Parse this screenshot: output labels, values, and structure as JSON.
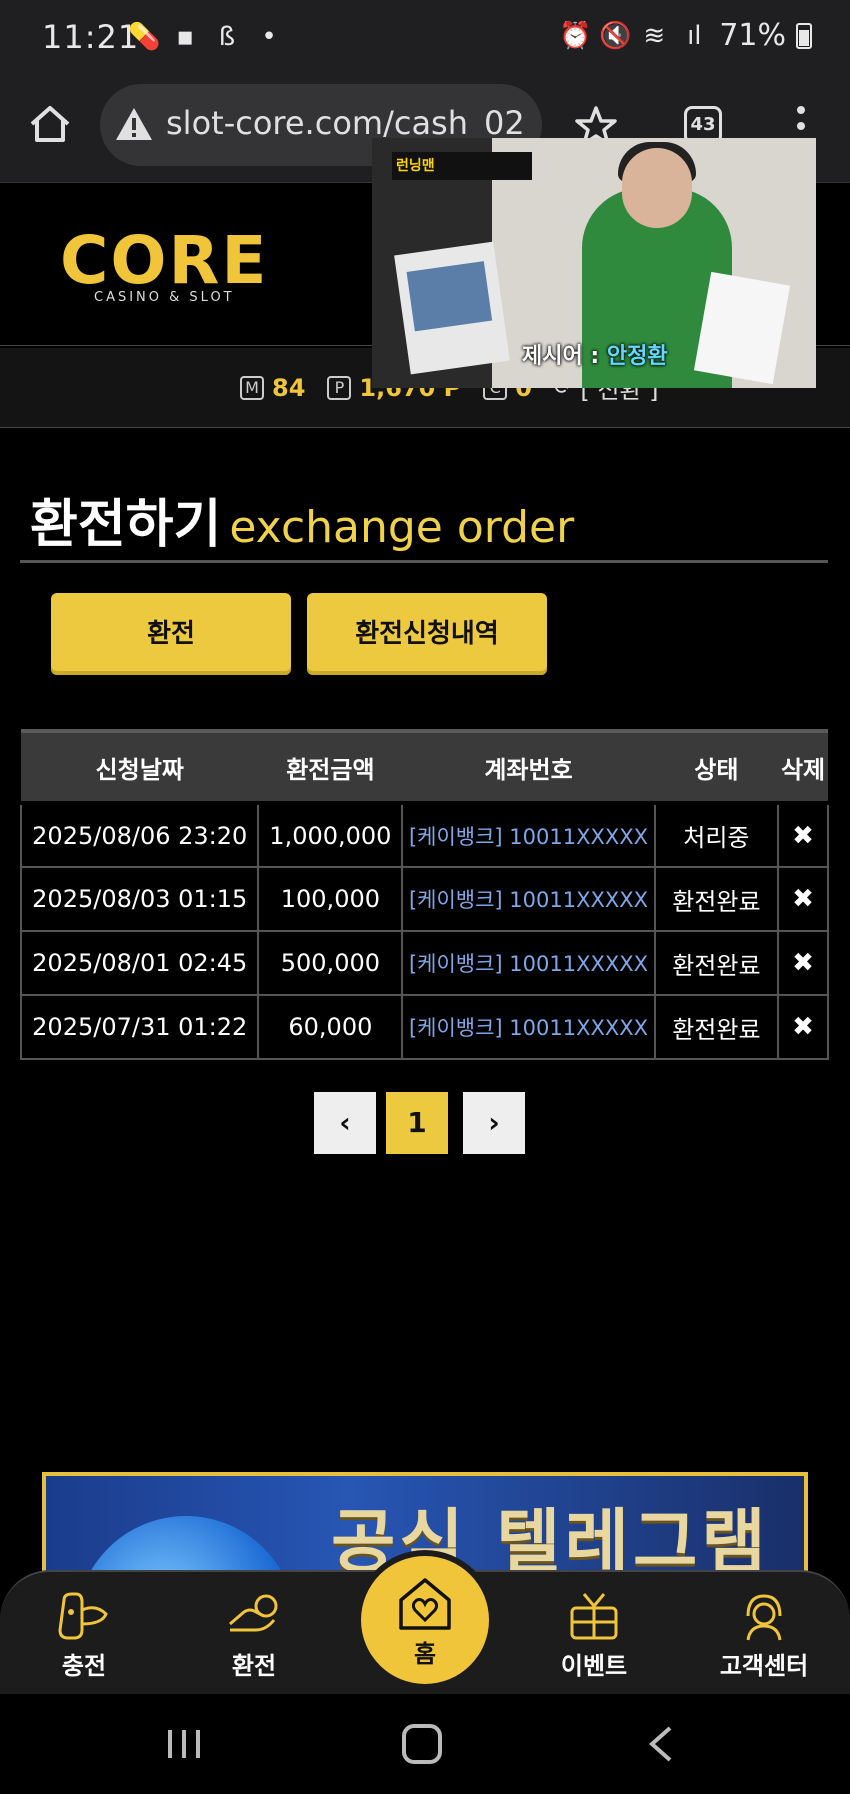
{
  "status_bar": {
    "time": "11:21",
    "battery": "71%"
  },
  "browser": {
    "url": "slot-core.com/cash_02_1",
    "tab_count": "43"
  },
  "site": {
    "logo": "CORE",
    "logo_sub": "CASINO & SLOT"
  },
  "user_bar": {
    "m_badge": "M",
    "m_value": "84",
    "p_badge": "P",
    "p_value": "1,670 P",
    "c_badge": "C",
    "c_value": "0",
    "convert_label": "[ 전환 ]"
  },
  "video_overlay": {
    "show_tag": "런닝맨",
    "caption_prefix": "제시어 : ",
    "caption_highlight": "안정환"
  },
  "page": {
    "title": "환전하기",
    "title_en": "exchange order"
  },
  "buttons": {
    "exchange": "환전",
    "history": "환전신청내역"
  },
  "table": {
    "headers": [
      "신청날짜",
      "환전금액",
      "계좌번호",
      "상태",
      "삭제"
    ],
    "rows": [
      {
        "date": "2025/08/06 23:20",
        "amount": "1,000,000",
        "account": "[케이뱅크] 10011XXXXX",
        "status": "처리중",
        "delete": "✖"
      },
      {
        "date": "2025/08/03 01:15",
        "amount": "100,000",
        "account": "[케이뱅크] 10011XXXXX",
        "status": "환전완료",
        "delete": "✖"
      },
      {
        "date": "2025/08/01 02:45",
        "amount": "500,000",
        "account": "[케이뱅크] 10011XXXXX",
        "status": "환전완료",
        "delete": "✖"
      },
      {
        "date": "2025/07/31 01:22",
        "amount": "60,000",
        "account": "[케이뱅크] 10011XXXXX",
        "status": "환전완료",
        "delete": "✖"
      }
    ]
  },
  "pagination": {
    "prev": "‹",
    "current": "1",
    "next": "›"
  },
  "banner": {
    "text": "공식 텔레그램"
  },
  "bottom_nav": {
    "charge": "충전",
    "exchange": "환전",
    "home": "홈",
    "event": "이벤트",
    "support": "고객센터"
  },
  "colors": {
    "accent": "#f0c53a",
    "button": "#ecc93f",
    "account_link": "#7fa7e8",
    "background": "#000000"
  }
}
